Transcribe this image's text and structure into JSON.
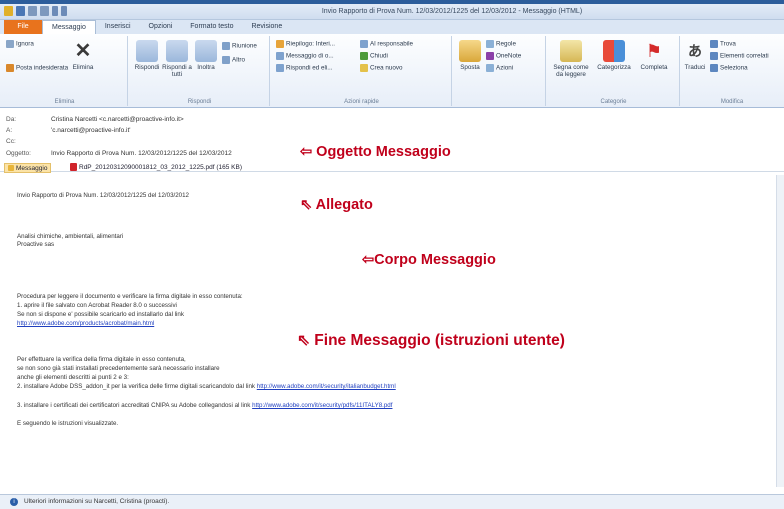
{
  "window": {
    "title": "Invio Rapporto di Prova Num. 12/03/2012/1225 del 12/03/2012 - Messaggio (HTML)"
  },
  "ribbon_tabs": [
    "File",
    "Messaggio",
    "Inserisci",
    "Opzioni",
    "Formato testo",
    "Revisione"
  ],
  "ribbon": {
    "elimina": {
      "ignore": "Ignora",
      "junk": "Posta indesiderata",
      "delete": "Elimina",
      "label": "Elimina"
    },
    "rispondi": {
      "reply": "Rispondi",
      "reply_all": "Rispondi a tutti",
      "forward": "Inoltra",
      "meeting": "Riunione",
      "other": "Altro",
      "label": "Rispondi"
    },
    "azioni_rapide": {
      "items": [
        "Riepilogo: Interi...",
        "Messaggio di o...",
        "Rispondi ed eli...",
        "Al responsabile",
        "Chiudi",
        "Crea nuovo"
      ],
      "label": "Azioni rapide"
    },
    "sposta": {
      "move": "Sposta",
      "rules": "Regole",
      "onenote": "OneNote",
      "actions": "Azioni"
    },
    "categorie": {
      "unread": "Segna come da leggere",
      "categorize": "Categorizza",
      "followup": "Completa",
      "label": "Categorie"
    },
    "modifica": {
      "translate": "Traduci",
      "find": "Trova",
      "related": "Elementi correlati",
      "select": "Seleziona",
      "label": "Modifica"
    }
  },
  "header": {
    "from_label": "Da:",
    "from": "Cristina Narcetti <c.narcetti@proactive-info.it>",
    "to_label": "A:",
    "to": "'c.narcetti@proactive-info.it'",
    "cc_label": "Cc:",
    "cc": "",
    "subject_label": "Oggetto:",
    "subject": "Invio Rapporto di Prova Num. 12/03/2012/1225 del 12/03/2012"
  },
  "attachments": {
    "message": "Messaggio",
    "file": "RdP_20120312090001812_03_2012_1225.pdf (165 KB)"
  },
  "callouts": {
    "subject": "⇦ Oggetto Messaggio",
    "attachment": "⇖ Allegato",
    "body": "⇦Corpo Messaggio",
    "end": "⇖ Fine Messaggio (istruzioni utente)"
  },
  "body": {
    "line1": "Invio Rapporto di Prova Num. 12/03/2012/1225 del 12/03/2012",
    "line2": "Analisi chimiche, ambientali, alimentari",
    "line3": "Proactive sas",
    "p1": "Procedura per leggere il documento e verificare la firma digitale in esso contenuta:",
    "p2": "1. aprire il file salvato con Acrobat Reader 8.0 o successivi",
    "p3": "Se non si dispone e' possibile scaricarlo ed installarlo dal link",
    "link1": "http://www.adobe.com/products/acrobat/main.html",
    "p4": "Per effettuare la verifica della firma digitale in esso contenuta,",
    "p5": "se non sono già stati installati precedentemente sarà necessario installare",
    "p6": "anche gli elementi descritti ai punti 2 e 3:",
    "p7": "2. installare Adobe DSS_addon_it per la verifica delle firme digitali scaricandolo dal link",
    "link2": "http://www.adobe.com/it/security/italianbudget.html",
    "p8": "3. installare i certificati dei certificatori accreditati CNIPA su Adobe collegandosi al link",
    "link3": "http://www.adobe.com/it/security/pdfs/11ITALY8.pdf",
    "p9": "E seguendo le istruzioni visualizzate."
  },
  "status": {
    "text": "Ulteriori informazioni su Narcetti, Cristina (proacti)."
  }
}
